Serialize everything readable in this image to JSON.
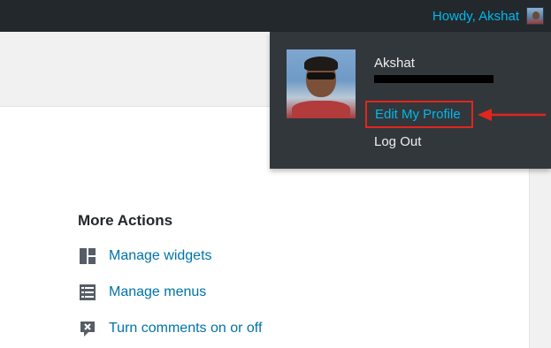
{
  "admin_bar": {
    "greeting": "Howdy, Akshat",
    "avatar_icon": "user-avatar"
  },
  "profile_menu": {
    "name": "Akshat",
    "edit_profile": "Edit My Profile",
    "log_out": "Log Out"
  },
  "more_actions": {
    "title": "More Actions",
    "items": [
      {
        "label": "Manage widgets",
        "icon": "widgets-icon"
      },
      {
        "label": "Manage menus",
        "icon": "menus-icon"
      },
      {
        "label": "Turn comments on or off",
        "icon": "comments-toggle-icon"
      }
    ]
  },
  "colors": {
    "admin_bar_bg": "#23282d",
    "dropdown_bg": "#32373c",
    "link_blue": "#0073aa",
    "highlight_blue": "#00b9eb",
    "annotation_red": "#e2261c"
  }
}
